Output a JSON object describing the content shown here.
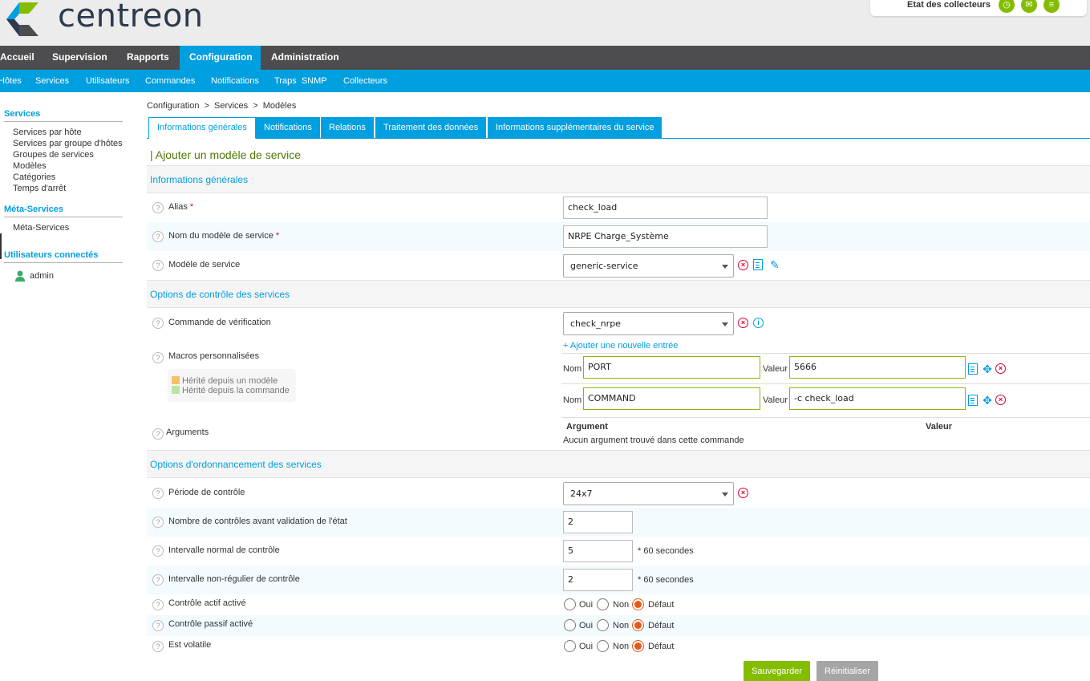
{
  "header": {
    "logo_text": "centreon",
    "pollers_label": "Etat des collecteurs",
    "poller_icons": [
      "clock-icon",
      "mail-icon",
      "database-icon"
    ]
  },
  "main_menu": [
    "Accueil",
    "Supervision",
    "Rapports",
    "Configuration",
    "Administration"
  ],
  "main_menu_active": "Configuration",
  "sub_menu": [
    "Hôtes",
    "Services",
    "Utilisateurs",
    "Commandes",
    "Notifications",
    "Traps  SNMP",
    "Collecteurs"
  ],
  "sidebar": {
    "services_title": "Services",
    "services_links": [
      "Services par hôte",
      "Services par groupe d'hôtes",
      "Groupes de services",
      "Modèles",
      "Catégories",
      "Temps d'arrêt"
    ],
    "meta_title": "Méta-Services",
    "meta_links": [
      "Méta-Services"
    ],
    "users_title": "Utilisateurs connectés",
    "users": [
      "admin"
    ]
  },
  "breadcrumb": [
    "Configuration",
    ">",
    "Services",
    ">",
    "Modèles"
  ],
  "tabs": [
    "Informations générales",
    "Notifications",
    "Relations",
    "Traitement des données",
    "Informations supplémentaires du service"
  ],
  "form": {
    "title": "| Ajouter un modèle de service",
    "section_general": "Informations générales",
    "alias_label": "Alias",
    "alias_value": "check_load",
    "name_label": "Nom du modèle de service",
    "name_value": "NRPE Charge_Système",
    "template_label": "Modèle de service",
    "template_value": "generic-service",
    "required_mark": "*",
    "section_check": "Options de contrôle des services",
    "command_label": "Commande de vérification",
    "command_value": "check_nrpe",
    "macros_label": "Macros personnalisées",
    "add_entry": "+ Ajouter une nouvelle entrée",
    "legend_template": "Hérité depuis un modèle",
    "legend_command": "Hérité depuis la commande",
    "macro_name_label": "Nom",
    "macro_value_label": "Valeur",
    "macros": [
      {
        "name": "PORT",
        "value": "5666"
      },
      {
        "name": "COMMAND",
        "value": "-c check_load"
      }
    ],
    "arguments_label": "Arguments",
    "arg_col_argument": "Argument",
    "arg_col_value": "Valeur",
    "no_argument": "Aucun argument trouvé dans cette commande",
    "section_schedule": "Options d'ordonnancement des services",
    "period_label": "Période de contrôle",
    "period_value": "24x7",
    "max_attempts_label": "Nombre de contrôles avant validation de l'état",
    "max_attempts_value": "2",
    "normal_interval_label": "Intervalle normal de contrôle",
    "normal_interval_value": "5",
    "retry_interval_label": "Intervalle non-régulier de contrôle",
    "retry_interval_value": "2",
    "seconds_suffix": "* 60 secondes",
    "active_label": "Contrôle actif activé",
    "passive_label": "Contrôle passif activé",
    "volatile_label": "Est volatile",
    "opt_yes": "Oui",
    "opt_no": "Non",
    "opt_default": "Défaut",
    "save_button": "Sauvegarder",
    "reset_button": "Réinitialiser"
  },
  "colors": {
    "brand_blue": "#009fdf",
    "menu_dark": "#4d4d4f",
    "green": "#84bd00",
    "title_green": "#4d7a00",
    "danger": "#e0002d",
    "legend_template": "#f5c26b",
    "legend_command": "#b8e5a0"
  }
}
